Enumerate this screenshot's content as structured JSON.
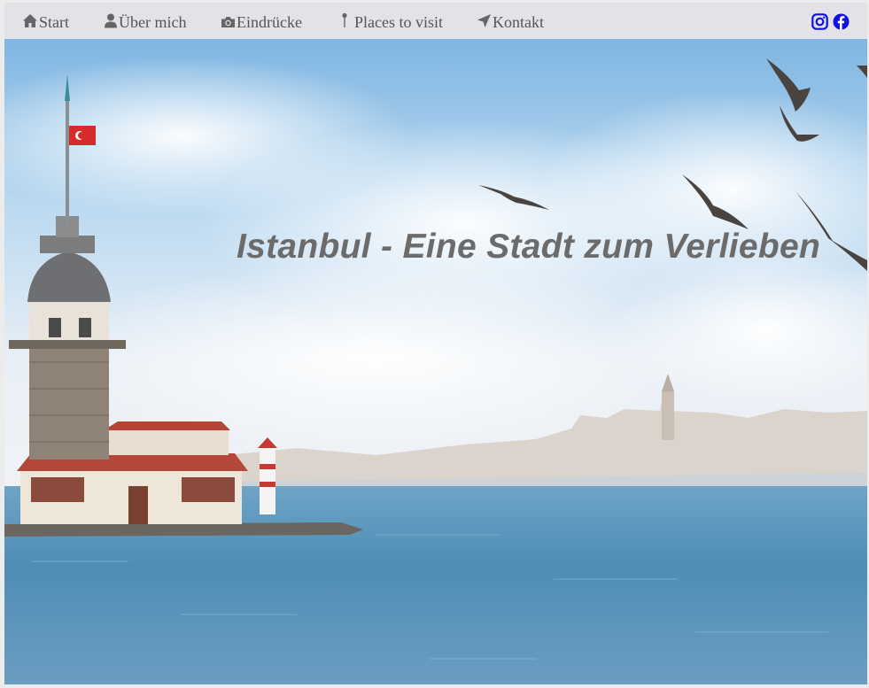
{
  "nav": {
    "items": [
      {
        "label": "Start",
        "icon": "home-icon"
      },
      {
        "label": "Über mich",
        "icon": "user-icon"
      },
      {
        "label": "Eindrücke",
        "icon": "camera-icon"
      },
      {
        "label": "Places to visit",
        "icon": "map-pin-icon"
      },
      {
        "label": "Kontakt",
        "icon": "send-icon"
      }
    ],
    "social": [
      {
        "icon": "instagram-icon",
        "color": "#1010e0"
      },
      {
        "icon": "facebook-icon",
        "color": "#1010e0"
      }
    ]
  },
  "hero": {
    "title": "Istanbul - Eine Stadt zum Verlieben",
    "image": "maidens-tower-bosphorus-photo"
  },
  "colors": {
    "navbar_bg": "#e4e2e6",
    "nav_text": "#555555",
    "title_text": "#6b6b6b",
    "sea": "#4d8fb6",
    "sky": "#9ec8e8"
  }
}
